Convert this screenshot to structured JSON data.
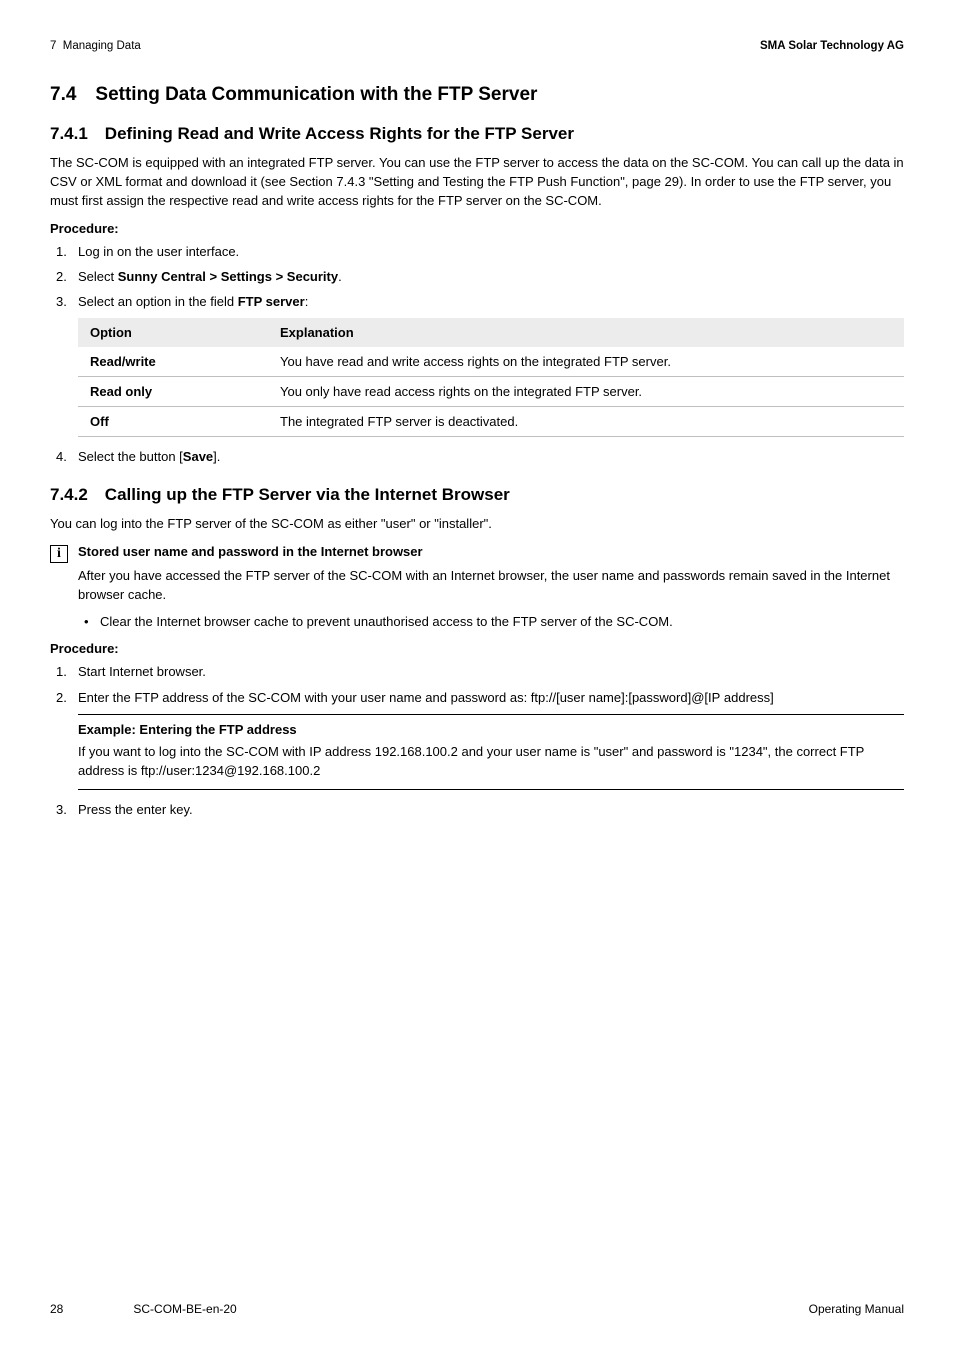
{
  "header": {
    "left": "7  Managing Data",
    "right": "SMA Solar Technology AG"
  },
  "s74": {
    "title": "7.4 Setting Data Communication with the FTP Server"
  },
  "s741": {
    "title": "7.4.1 Defining Read and Write Access Rights for the FTP Server",
    "intro": "The SC-COM is equipped with an integrated FTP server. You can use the FTP server to access the data on the SC-COM. You can call up the data in CSV or XML format and download it (see Section 7.4.3 \"Setting and Testing the FTP Push Function\", page 29). In order to use the FTP server, you must first assign the respective read and write access rights for the FTP server on the SC-COM.",
    "procedure_label": "Procedure:",
    "steps": {
      "s1": "Log in on the user interface.",
      "s2_pre": "Select ",
      "s2_bold": "Sunny Central > Settings > Security",
      "s2_post": ".",
      "s3_pre": "Select an option in the field ",
      "s3_bold": "FTP server",
      "s3_post": ":"
    },
    "table": {
      "h_option": "Option",
      "h_explanation": "Explanation",
      "rows": [
        {
          "opt": "Read/write",
          "exp": "You have read and write access rights on the integrated FTP server."
        },
        {
          "opt": "Read only",
          "exp": "You only have read access rights on the integrated FTP server."
        },
        {
          "opt": "Off",
          "exp": "The integrated FTP server is deactivated."
        }
      ]
    },
    "step4_pre": "Select the button [",
    "step4_bold": "Save",
    "step4_post": "]."
  },
  "s742": {
    "title": "7.4.2 Calling up the FTP Server via the Internet Browser",
    "intro": "You can log into the FTP server of the SC-COM as either \"user\" or \"installer\".",
    "info": {
      "title": "Stored user name and password in the Internet browser",
      "body": "After you have accessed the FTP server of the SC-COM with an Internet browser, the user name and passwords remain saved in the Internet browser cache.",
      "bullet": "Clear the Internet browser cache to prevent unauthorised access to the FTP server of the SC-COM."
    },
    "procedure_label": "Procedure:",
    "steps": {
      "s1": "Start Internet browser.",
      "s2": "Enter the FTP address of the SC-COM with your user name and password as: ftp://[user name]:[password]@[IP address]"
    },
    "example": {
      "title": "Example: Entering the FTP address",
      "body": "If you want to log into the SC-COM with IP address 192.168.100.2 and your user name is \"user\" and password is \"1234\", the correct FTP address is ftp://user:1234@192.168.100.2"
    },
    "step3": "Press the enter key."
  },
  "footer": {
    "page": "28",
    "doc_id": "SC-COM-BE-en-20",
    "manual": "Operating Manual"
  }
}
